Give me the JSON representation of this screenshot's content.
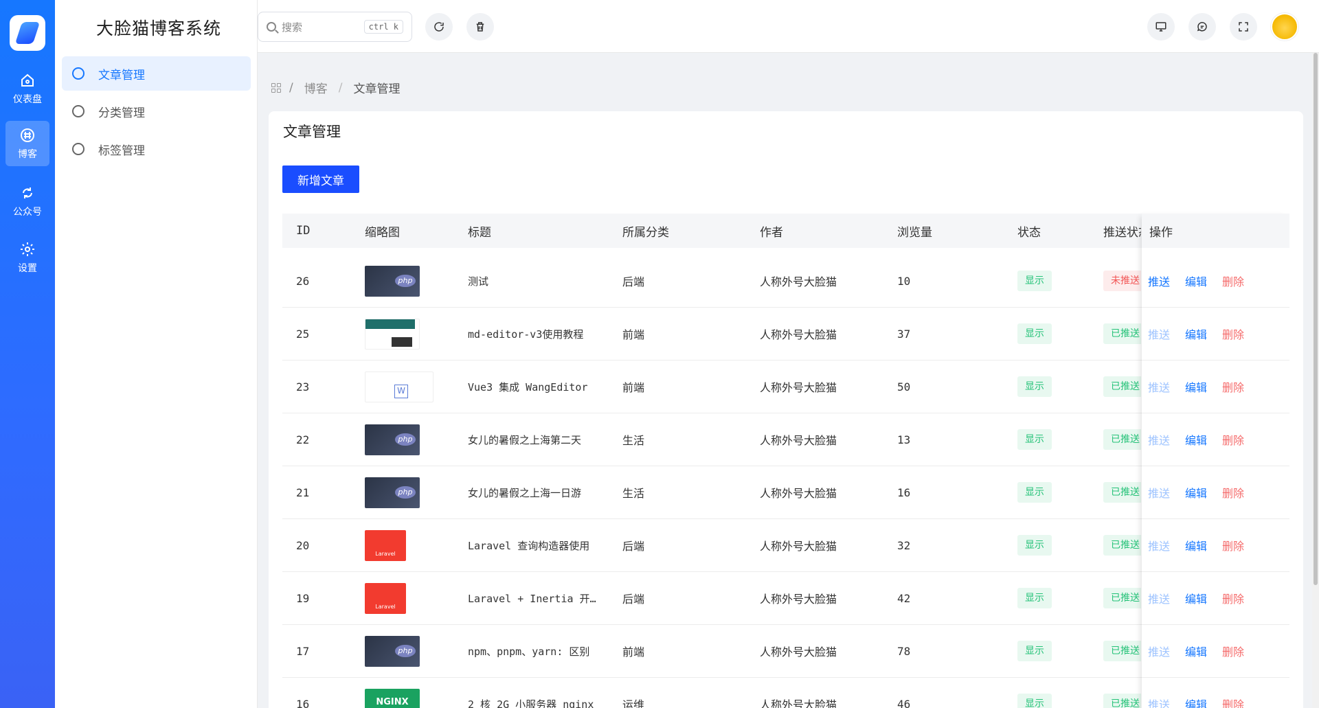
{
  "rail": {
    "items": [
      {
        "label": "仪表盘",
        "icon": "home-icon",
        "active": false
      },
      {
        "label": "博客",
        "icon": "blog-icon",
        "active": true
      },
      {
        "label": "公众号",
        "icon": "wechat-icon",
        "active": false
      },
      {
        "label": "设置",
        "icon": "gear-icon",
        "active": false
      }
    ]
  },
  "brand": "大脸猫博客系统",
  "submenu": [
    {
      "label": "文章管理",
      "active": true
    },
    {
      "label": "分类管理",
      "active": false
    },
    {
      "label": "标签管理",
      "active": false
    }
  ],
  "header": {
    "search_placeholder": "搜索",
    "search_shortcut": "ctrl k"
  },
  "breadcrumb": {
    "parent": "博客",
    "current": "文章管理",
    "sep": "/"
  },
  "card": {
    "title": "文章管理",
    "add_button": "新增文章"
  },
  "table": {
    "columns": {
      "id": "ID",
      "thumb": "缩略图",
      "title": "标题",
      "category": "所属分类",
      "author": "作者",
      "views": "浏览量",
      "status": "状态",
      "push": "推送状态",
      "ops": "操作"
    },
    "ops_labels": {
      "push": "推送",
      "edit": "编辑",
      "delete": "删除"
    },
    "rows": [
      {
        "id": "26",
        "thumb": "php",
        "title": "测试",
        "category": "后端",
        "author": "人称外号大脸猫",
        "views": "10",
        "status": "显示",
        "push": "未推送",
        "push_enabled": true
      },
      {
        "id": "25",
        "thumb": "md",
        "title": "md-editor-v3使用教程",
        "category": "前端",
        "author": "人称外号大脸猫",
        "views": "37",
        "status": "显示",
        "push": "已推送",
        "push_enabled": false
      },
      {
        "id": "23",
        "thumb": "wang",
        "title": "Vue3 集成 WangEditor",
        "category": "前端",
        "author": "人称外号大脸猫",
        "views": "50",
        "status": "显示",
        "push": "已推送",
        "push_enabled": false
      },
      {
        "id": "22",
        "thumb": "php",
        "title": "女儿的暑假之上海第二天",
        "category": "生活",
        "author": "人称外号大脸猫",
        "views": "13",
        "status": "显示",
        "push": "已推送",
        "push_enabled": false
      },
      {
        "id": "21",
        "thumb": "php",
        "title": "女儿的暑假之上海一日游",
        "category": "生活",
        "author": "人称外号大脸猫",
        "views": "16",
        "status": "显示",
        "push": "已推送",
        "push_enabled": false
      },
      {
        "id": "20",
        "thumb": "laravel",
        "title": "Laravel 查询构造器使用",
        "category": "后端",
        "author": "人称外号大脸猫",
        "views": "32",
        "status": "显示",
        "push": "已推送",
        "push_enabled": false
      },
      {
        "id": "19",
        "thumb": "laravel",
        "title": "Laravel + Inertia 开发",
        "category": "后端",
        "author": "人称外号大脸猫",
        "views": "42",
        "status": "显示",
        "push": "已推送",
        "push_enabled": false
      },
      {
        "id": "17",
        "thumb": "php",
        "title": "npm、pnpm、yarn: 区别",
        "category": "前端",
        "author": "人称外号大脸猫",
        "views": "78",
        "status": "显示",
        "push": "已推送",
        "push_enabled": false
      },
      {
        "id": "16",
        "thumb": "nginx",
        "title": "2 核 2G 小服务器 nginx",
        "category": "运维",
        "author": "人称外号大脸猫",
        "views": "46",
        "status": "显示",
        "push": "已推送",
        "push_enabled": false
      }
    ]
  },
  "colors": {
    "primary": "#1a4dff",
    "rail": "#1677ff",
    "success": "#25c278",
    "danger": "#f56c6c"
  }
}
